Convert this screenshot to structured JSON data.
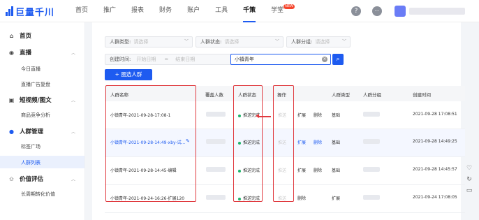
{
  "brand": {
    "name": "巨量千川",
    "color": "#1e5bf0"
  },
  "nav": {
    "items": [
      {
        "label": "首页"
      },
      {
        "label": "推广"
      },
      {
        "label": "报表"
      },
      {
        "label": "财务"
      },
      {
        "label": "账户"
      },
      {
        "label": "工具"
      },
      {
        "label": "千策",
        "active": true
      },
      {
        "label": "学堂",
        "badge": "NEW"
      }
    ],
    "help_icon": "?",
    "more_icon": "···"
  },
  "sidebar": {
    "home": "首页",
    "live": {
      "title": "直播",
      "items": [
        "今日直播",
        "直播广告复盘"
      ]
    },
    "video": {
      "title": "短视频/图文",
      "items": [
        "商品竞争分析"
      ]
    },
    "audience": {
      "title": "人群管理",
      "items": [
        "标签广场",
        "人群列表"
      ],
      "active": "人群列表"
    },
    "value": {
      "title": "价值评估",
      "items": [
        "长周期转化价值"
      ]
    }
  },
  "filters": {
    "type": {
      "label": "人群类型:",
      "placeholder": "请选择"
    },
    "status": {
      "label": "人群状态:",
      "placeholder": "请选择"
    },
    "group": {
      "label": "人群分组:",
      "placeholder": "请选择"
    },
    "time": {
      "label": "创建时间:",
      "start": "开始日期",
      "sep": "~",
      "end": "结束日期"
    },
    "search_value": "小镇青年",
    "clear_icon": "×",
    "search_icon": "⌕"
  },
  "add_button": "+ 圈选人群",
  "table": {
    "headers": [
      "人群名称",
      "覆盖人数",
      "人群状态",
      "操作",
      "人群类型",
      "人群分组",
      "创建时间"
    ],
    "rows": [
      {
        "name": "小镇青年-2021-09-28-17:08-1",
        "status": "推送完成",
        "op1": "推送",
        "op2": "扩展",
        "op3": "删除",
        "type": "基础",
        "time": "2021-09-28 17:08:51"
      },
      {
        "name": "小镇青年-2021-09-28-14:49-xby-试…",
        "status": "推送完成",
        "op1": "推送",
        "op2": "扩展",
        "op3": "删除",
        "type": "基础",
        "time": "2021-09-28 14:49:25"
      },
      {
        "name": "小镇青年-2021-09-28-14:45-编辑",
        "status": "推送完成",
        "op1": "推送",
        "op2": "扩展",
        "op3": "删除",
        "type": "基础",
        "time": "2021-09-28 14:45:57"
      },
      {
        "name": "小镇青年-2021-09-24-16:26-扩展120",
        "status": "推送完成",
        "op1": "推送",
        "op2": "删除",
        "op3": "扩展",
        "type": "",
        "time": "2021-09-24 17:08:05"
      }
    ]
  }
}
